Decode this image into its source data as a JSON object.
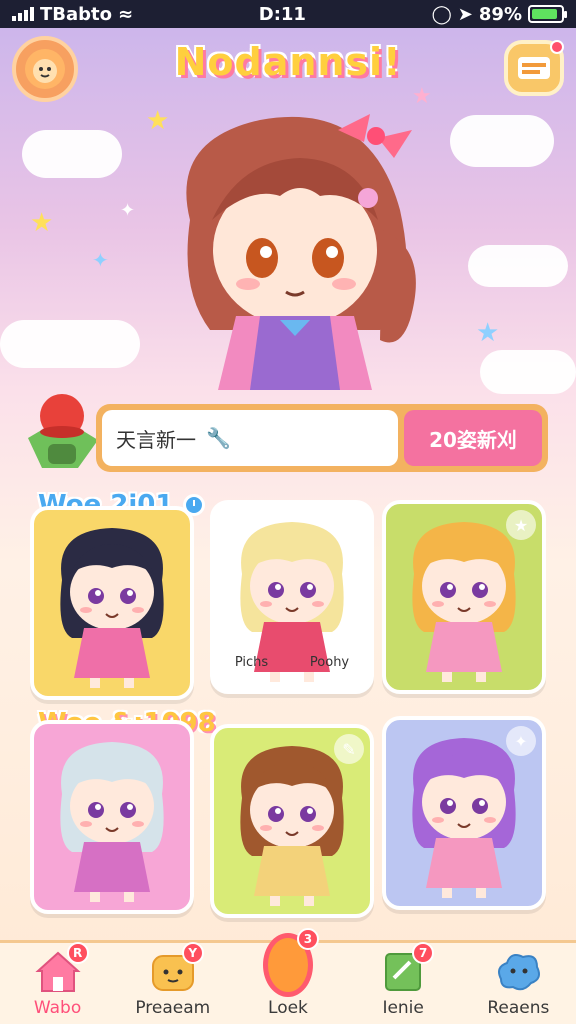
{
  "status_bar": {
    "carrier": "TBabto",
    "time": "D:11",
    "battery": "89%"
  },
  "header": {
    "title": "Nodannsi!"
  },
  "search": {
    "placeholder": "天言新一",
    "button_label": "20姿新刈"
  },
  "sections": [
    {
      "label": "Woe 2i01"
    },
    {
      "label": "Woe &:1098"
    }
  ],
  "cards": [
    {
      "bg": "#f9d769",
      "hair": "#2b2b44",
      "dress": "#ef6fa8"
    },
    {
      "bg": "#ffffff",
      "hair": "#f5e49c",
      "dress": "#e84c6e",
      "caption_left": "Pichs",
      "caption_right": "Poohy"
    },
    {
      "bg": "#c8dd6a",
      "hair": "#f4b548",
      "dress": "#f598c0"
    },
    {
      "bg": "#f7a6d6",
      "hair": "#d5e3ea",
      "dress": "#d670c4"
    },
    {
      "bg": "#d9eb77",
      "hair": "#a0582e",
      "dress": "#f3d27a"
    },
    {
      "bg": "#bcc6f2",
      "hair": "#a566d8",
      "dress": "#f598c0"
    }
  ],
  "nav": [
    {
      "label": "Wabo",
      "badge": "R",
      "active": true,
      "color": "#ff7aa2"
    },
    {
      "label": "Preaeam",
      "badge": "Y",
      "color": "#f9c150"
    },
    {
      "label": "Loek",
      "badge": "3",
      "color": "#ff9a3a"
    },
    {
      "label": "Ienie",
      "badge": "7",
      "color": "#74c15a"
    },
    {
      "label": "Reaens",
      "badge": "",
      "color": "#5aa8e8"
    }
  ]
}
